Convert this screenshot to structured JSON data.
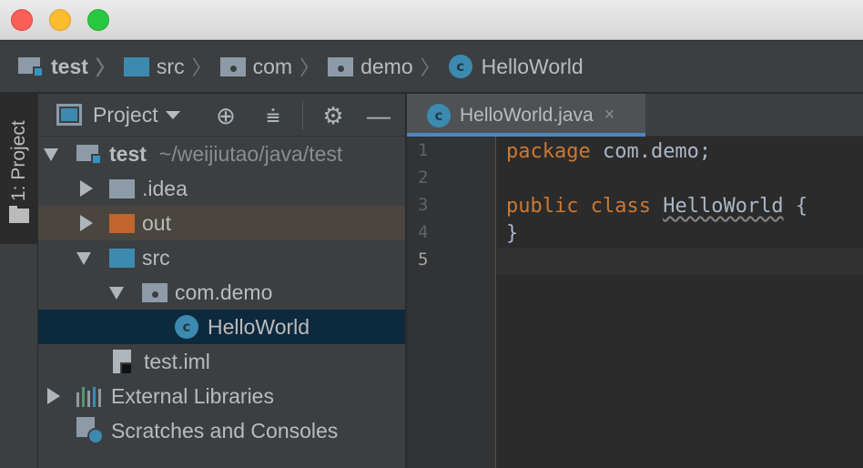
{
  "window": {
    "buttons": [
      "close",
      "minimize",
      "zoom"
    ]
  },
  "breadcrumb": {
    "items": [
      {
        "label": "test",
        "icon": "project-folder-icon"
      },
      {
        "label": "src",
        "icon": "source-folder-icon"
      },
      {
        "label": "com",
        "icon": "package-icon"
      },
      {
        "label": "demo",
        "icon": "package-icon"
      },
      {
        "label": "HelloWorld",
        "icon": "class-icon"
      }
    ],
    "separator": "〉"
  },
  "tool_stripe": {
    "project_tab_label": "1: Project"
  },
  "project_panel": {
    "view_label": "Project",
    "toolbar_icons": [
      "locate-icon",
      "collapse-all-icon",
      "settings-gear-icon",
      "hide-icon"
    ],
    "tree": {
      "root_label": "test",
      "root_path": "~/weijiutao/java/test",
      "idea_label": ".idea",
      "out_label": "out",
      "src_label": "src",
      "package_label": "com.demo",
      "class_label": "HelloWorld",
      "iml_label": "test.iml",
      "external_libraries_label": "External Libraries",
      "scratches_label": "Scratches and Consoles"
    }
  },
  "editor": {
    "tab_label": "HelloWorld.java",
    "tab_close": "×",
    "line_numbers": [
      "1",
      "2",
      "3",
      "4",
      "5"
    ],
    "code": {
      "line1_kw": "package",
      "line1_rest": " com.demo;",
      "line3_kw1": "public",
      "line3_kw2": "class",
      "line3_class": "HelloWorld",
      "line3_brace": " {",
      "line4": "}"
    }
  },
  "colors": {
    "keyword": "#cc7832",
    "text": "#a9b7c6",
    "selection": "#0d293e",
    "accent": "#4a88c7"
  }
}
